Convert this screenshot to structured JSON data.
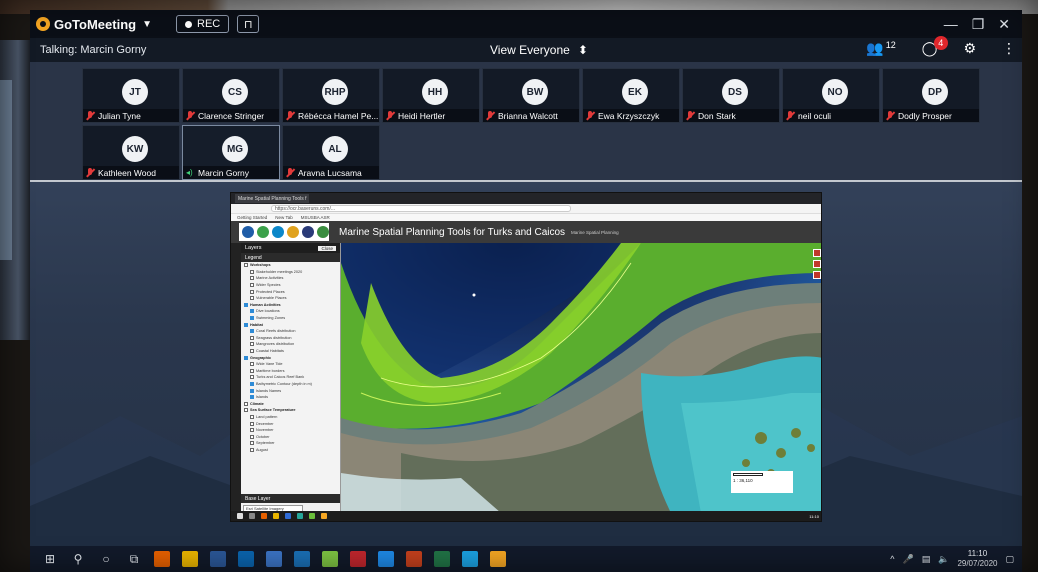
{
  "app": {
    "brand": "GoToMeeting",
    "rec_label": "REC",
    "talking": "Talking: Marcin Gorny",
    "view_label": "View Everyone",
    "participants_count": "12",
    "chat_badge": "4"
  },
  "participants": [
    {
      "initials": "JT",
      "name": "Julian Tyne",
      "muted": true
    },
    {
      "initials": "CS",
      "name": "Clarence Stringer",
      "muted": true
    },
    {
      "initials": "RHP",
      "name": "Rébécca Hamel Pe...",
      "muted": true
    },
    {
      "initials": "HH",
      "name": "Heidi Hertler",
      "muted": true
    },
    {
      "initials": "BW",
      "name": "Brianna Walcott",
      "muted": true
    },
    {
      "initials": "EK",
      "name": "Ewa Krzyszczyk",
      "muted": true
    },
    {
      "initials": "DS",
      "name": "Don Stark",
      "muted": true
    },
    {
      "initials": "NO",
      "name": "neil oculi",
      "muted": true
    },
    {
      "initials": "DP",
      "name": "Dodly Prosper",
      "muted": true
    },
    {
      "initials": "KW",
      "name": "Kathleen Wood",
      "muted": true
    },
    {
      "initials": "MG",
      "name": "Marcin Gorny",
      "muted": false
    },
    {
      "initials": "AL",
      "name": "Aravna Lucsama",
      "muted": true
    }
  ],
  "shared": {
    "tab_title": "Marine Spatial Planning Tools f",
    "url": "https://ocr.baseruns.com/...",
    "bookmarks": [
      "Getting Started",
      "New Tab",
      "MSUSBA ASR"
    ],
    "app_title": "Marine Spatial Planning Tools for Turks and Caicos",
    "app_subtitle": "Marine Spatial Planning",
    "layers_title": "Layers",
    "close_label": "Close",
    "legend_label": "Legend",
    "base_layer_label": "Base Layer",
    "base_select": "Esri Satellite Imagery",
    "scale_text": "1 : 36,110",
    "layer_rows": [
      {
        "label": "Workshops",
        "group": true,
        "on": false
      },
      {
        "label": "Stakeholder meetings 2020",
        "group": false,
        "on": false
      },
      {
        "label": "Marine Activities",
        "group": false,
        "on": false
      },
      {
        "label": "Wider Species",
        "group": false,
        "on": false
      },
      {
        "label": "Protected Places",
        "group": false,
        "on": false
      },
      {
        "label": "Vulnerable Places",
        "group": false,
        "on": false
      },
      {
        "label": "Human Activities",
        "group": true,
        "on": true
      },
      {
        "label": "Dive locations",
        "group": false,
        "on": true
      },
      {
        "label": "Swimming Zones",
        "group": false,
        "on": true
      },
      {
        "label": "Habitat",
        "group": true,
        "on": true
      },
      {
        "label": "Coral Reefs distribution",
        "group": false,
        "on": true
      },
      {
        "label": "Seagrass distribution",
        "group": false,
        "on": false
      },
      {
        "label": "Mangroves distribution",
        "group": false,
        "on": false
      },
      {
        "label": "Coastal Habitats",
        "group": false,
        "on": false
      },
      {
        "label": "Geographic",
        "group": true,
        "on": true
      },
      {
        "label": "Wide Vane Tide",
        "group": false,
        "on": false
      },
      {
        "label": "Maritime borders",
        "group": false,
        "on": false
      },
      {
        "label": "Turks and Caicos Reef Bank",
        "group": false,
        "on": false
      },
      {
        "label": "Bathymetric Contour (depth in m)",
        "group": false,
        "on": true
      },
      {
        "label": "Islands Names",
        "group": false,
        "on": true
      },
      {
        "label": "Islands",
        "group": false,
        "on": true
      },
      {
        "label": "Climate",
        "group": true,
        "on": false
      },
      {
        "label": "Sea Surface Temperature",
        "group": true,
        "on": false
      },
      {
        "label": "Land pattern",
        "group": false,
        "on": false
      },
      {
        "label": "December",
        "group": false,
        "on": false
      },
      {
        "label": "November",
        "group": false,
        "on": false
      },
      {
        "label": "October",
        "group": false,
        "on": false
      },
      {
        "label": "September",
        "group": false,
        "on": false
      },
      {
        "label": "August",
        "group": false,
        "on": false
      }
    ],
    "inner_clock": "11:10"
  },
  "taskbar": {
    "time": "11:10",
    "date": "29/07/2020"
  },
  "colors": {
    "brand_accent": "#f5a623",
    "muted_mic": "#e13a3a",
    "live_mic": "#42d37a",
    "badge": "#e0272c"
  }
}
